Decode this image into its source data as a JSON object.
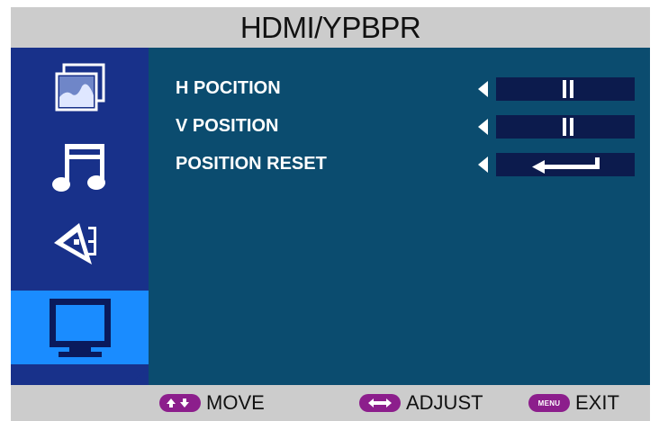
{
  "title": "HDMI/YPBPR",
  "sidebar": {
    "items": [
      {
        "icon": "picture-icon",
        "active": false
      },
      {
        "icon": "music-note-icon",
        "active": false
      },
      {
        "icon": "pen-nib-icon",
        "active": false
      },
      {
        "icon": "monitor-icon",
        "active": true
      }
    ]
  },
  "menu": {
    "items": [
      {
        "label": "H POCITION",
        "control": "slider-field"
      },
      {
        "label": "V POSITION",
        "control": "slider-field"
      },
      {
        "label": "POSITION RESET",
        "control": "enter-field"
      }
    ]
  },
  "footer": {
    "move_label": "MOVE",
    "adjust_label": "ADJUST",
    "exit_label": "EXIT",
    "menu_key": "MENU"
  },
  "colors": {
    "sidebar": "#18318a",
    "sidebar_active": "#1a8cff",
    "main": "#0b4c6f",
    "field": "#0c1b4d",
    "key_pill": "#8c1e8c",
    "bar": "#cccccc"
  }
}
